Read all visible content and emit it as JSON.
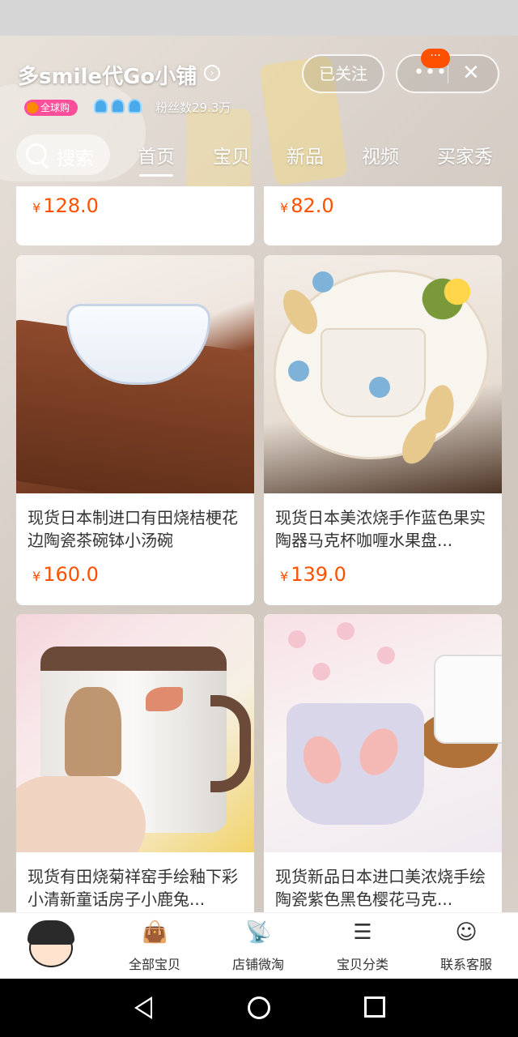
{
  "shop": {
    "name": "多smile代Go小铺",
    "follow_label": "已关注",
    "more_label": "•••",
    "close_label": "✕",
    "msg_badge": "···",
    "global_tag": "全球购",
    "fans": "粉丝数29.3万"
  },
  "search": {
    "label": "搜索"
  },
  "tabs": [
    "首页",
    "宝贝",
    "新品",
    "视频",
    "买家秀"
  ],
  "currency_symbol": "¥",
  "products": [
    {
      "name": "",
      "price": "128.0"
    },
    {
      "name": "",
      "price": "82.0"
    },
    {
      "name": "现货日本制进口有田烧桔梗花边陶瓷茶碗钵小汤碗",
      "price": "160.0"
    },
    {
      "name": "现货日本美浓烧手作蓝色果实陶器马克杯咖喱水果盘...",
      "price": "139.0"
    },
    {
      "name": "现货有田烧菊祥窑手绘釉下彩小清新童话房子小鹿兔...",
      "price": ""
    },
    {
      "name": "现货新品日本进口美浓烧手绘陶瓷紫色黑色樱花马克...",
      "price": ""
    }
  ],
  "bottom_nav": [
    {
      "label": "全部宝贝",
      "icon": "shopping-bag-icon"
    },
    {
      "label": "店铺微淘",
      "icon": "broadcast-icon"
    },
    {
      "label": "宝贝分类",
      "icon": "list-icon"
    },
    {
      "label": "联系客服",
      "icon": "chat-face-icon"
    }
  ]
}
